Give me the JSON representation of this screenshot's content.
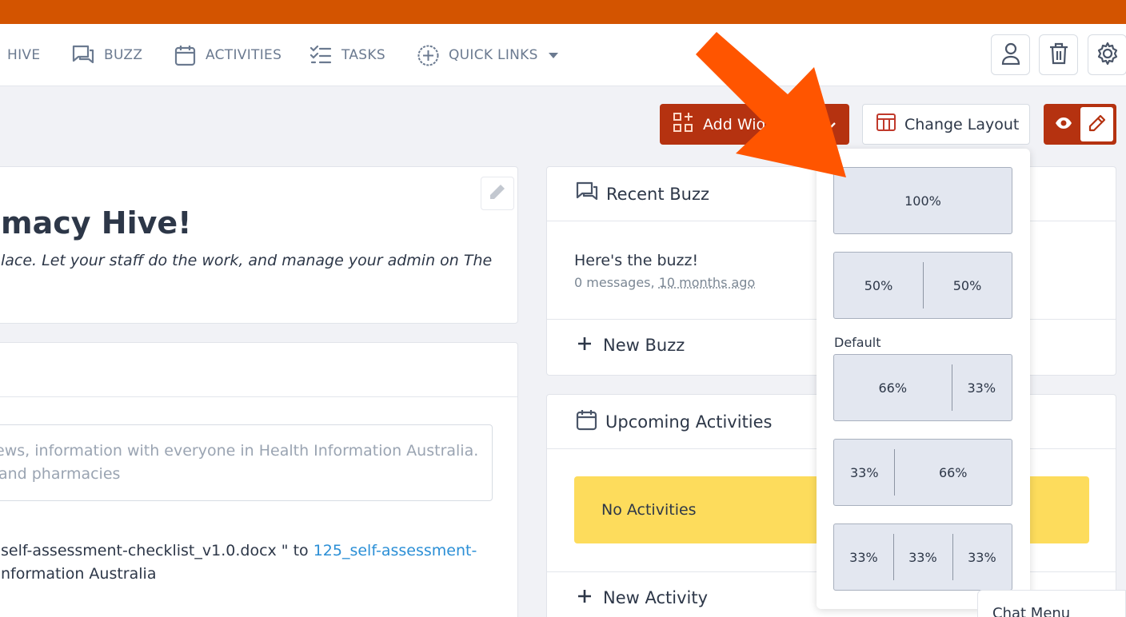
{
  "nav": {
    "items": [
      {
        "label": "HIVE"
      },
      {
        "label": "BUZZ"
      },
      {
        "label": "ACTIVITIES"
      },
      {
        "label": "TASKS"
      },
      {
        "label": "QUICK LINKS"
      }
    ]
  },
  "toolbar": {
    "add_widget_label": "Add Widget",
    "change_layout_label": "Change Layout"
  },
  "welcome": {
    "title": "macy Hive!",
    "text": "lace. Let your staff do the work, and manage your admin on The"
  },
  "post": {
    "placeholder_line1": "news, information with everyone in Health Information Australia.",
    "placeholder_line2": "s and pharmacies",
    "activity_line1_prefix": "self-assessment-checklist_v1.0.docx \" to ",
    "activity_link": "125_self-assessment-",
    "activity_line2": "nformation Australia"
  },
  "buzz": {
    "header": "Recent Buzz",
    "item_title": "Here's the buzz!",
    "item_meta_count": "0 messages,",
    "item_meta_time": "10 months ago",
    "new_label": "New Buzz"
  },
  "activities": {
    "header": "Upcoming Activities",
    "empty_label": "No Activities",
    "new_label": "New Activity"
  },
  "layout_menu": {
    "default_label": "Default",
    "options": [
      {
        "cols": [
          "100%"
        ]
      },
      {
        "cols": [
          "50%",
          "50%"
        ]
      },
      {
        "cols": [
          "66%",
          "33%"
        ]
      },
      {
        "cols": [
          "33%",
          "66%"
        ]
      },
      {
        "cols": [
          "33%",
          "33%",
          "33%"
        ]
      }
    ]
  },
  "chat": {
    "label": "Chat Menu"
  },
  "colors": {
    "top_bar": "#d35400",
    "accent": "#b53210",
    "arrow": "#ff5500",
    "warning": "#fddc5c"
  },
  "icons": {
    "buzz": "chat-bubbles-icon",
    "activities": "calendar-icon",
    "tasks": "checklist-icon",
    "quick_links": "plus-circle-icon",
    "profile": "user-icon",
    "trash": "trash-icon",
    "settings": "gear-icon",
    "view": "eye-icon",
    "edit": "pencil-icon"
  }
}
